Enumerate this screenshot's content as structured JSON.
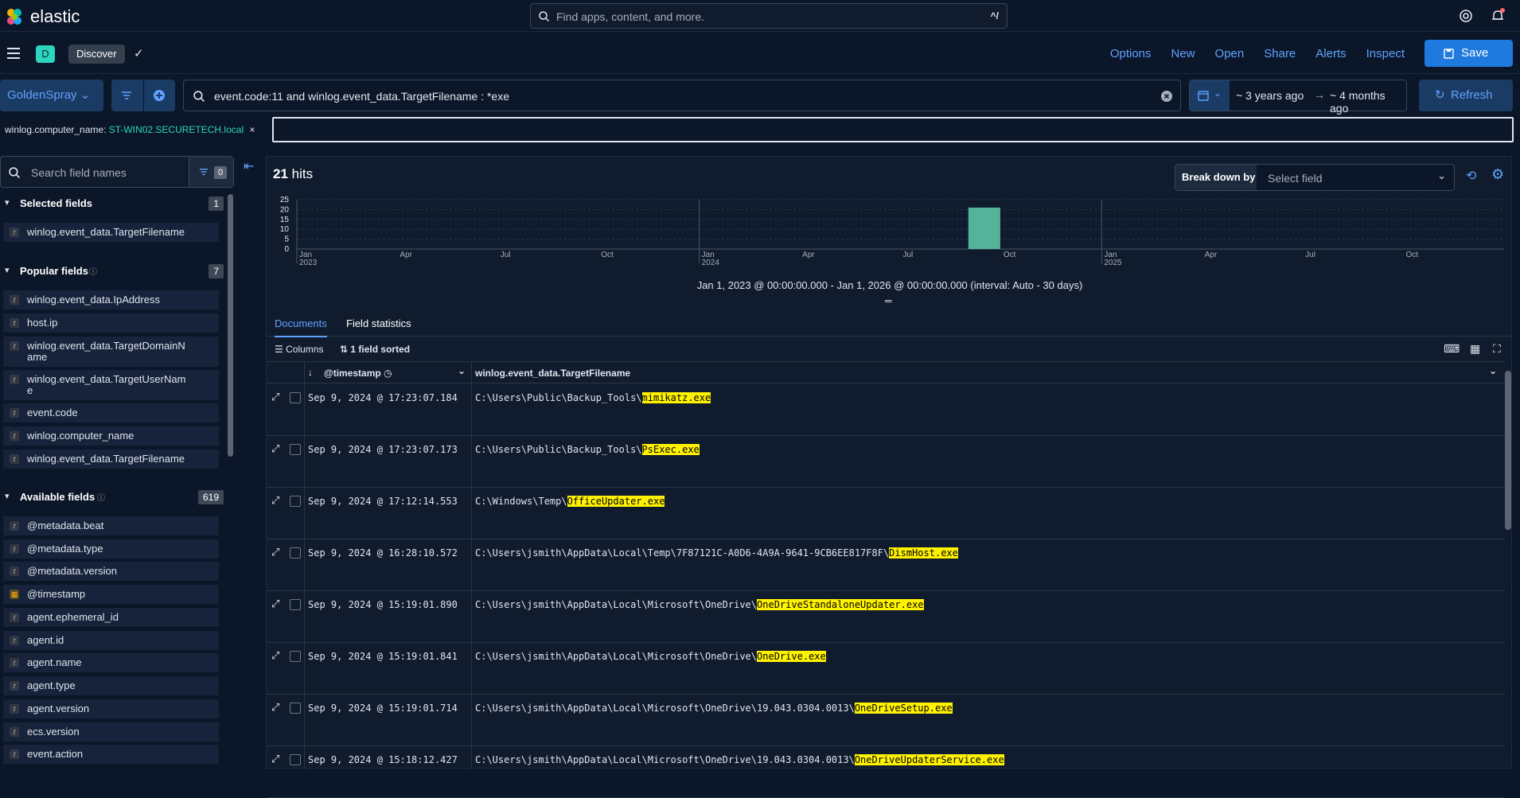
{
  "header": {
    "brand": "elastic",
    "search_placeholder": "Find apps, content, and more.",
    "search_shortcut": "^/"
  },
  "appbar": {
    "space_badge": "D",
    "breadcrumb": "Discover",
    "links": [
      "Options",
      "New",
      "Open",
      "Share",
      "Alerts",
      "Inspect"
    ],
    "save_label": "Save"
  },
  "querybar": {
    "data_view": "GoldenSpray",
    "query": "event.code:11 and winlog.event_data.TargetFilename : *exe",
    "date_start": "~ 3 years ago",
    "date_end": "~ 4 months ago",
    "refresh_label": "Refresh"
  },
  "filters": [
    {
      "key": "winlog.computer_name:",
      "value": "ST-WIN02.SECURETECH.local"
    }
  ],
  "sidebar": {
    "search_placeholder": "Search field names",
    "filter_count": "0",
    "selected": {
      "title": "Selected fields",
      "count": "1",
      "items": [
        "winlog.event_data.TargetFilename"
      ]
    },
    "popular": {
      "title": "Popular fields",
      "count": "7",
      "items": [
        "winlog.event_data.IpAddress",
        "host.ip",
        "winlog.event_data.TargetDomainName",
        "winlog.event_data.TargetUserName",
        "event.code",
        "winlog.computer_name",
        "winlog.event_data.TargetFilename"
      ]
    },
    "available": {
      "title": "Available fields",
      "count": "619",
      "items": [
        "@metadata.beat",
        "@metadata.type",
        "@metadata.version",
        "@timestamp",
        "agent.ephemeral_id",
        "agent.id",
        "agent.name",
        "agent.type",
        "agent.version",
        "ecs.version",
        "event.action"
      ]
    }
  },
  "main": {
    "hits_count": "21",
    "hits_label": "hits",
    "breakdown_label": "Break down by",
    "breakdown_placeholder": "Select field",
    "interval_text": "Jan 1, 2023 @ 00:00:00.000 - Jan 1, 2026 @ 00:00:00.000 (interval: Auto - 30 days)",
    "tabs": [
      "Documents",
      "Field statistics"
    ],
    "columns_label": "Columns",
    "sorted_label": "1 field sorted",
    "col_timestamp": "@timestamp",
    "col_filename": "winlog.event_data.TargetFilename"
  },
  "chart_data": {
    "type": "bar",
    "yticks": [
      "25",
      "20",
      "15",
      "10",
      "5",
      "0"
    ],
    "ylim": [
      0,
      25
    ],
    "xticks": [
      {
        "label": "Jan",
        "sub": "2023"
      },
      {
        "label": "Apr",
        "sub": ""
      },
      {
        "label": "Jul",
        "sub": ""
      },
      {
        "label": "Oct",
        "sub": ""
      },
      {
        "label": "Jan",
        "sub": "2024"
      },
      {
        "label": "Apr",
        "sub": ""
      },
      {
        "label": "Jul",
        "sub": ""
      },
      {
        "label": "Oct",
        "sub": ""
      },
      {
        "label": "Jan",
        "sub": "2025"
      },
      {
        "label": "Apr",
        "sub": ""
      },
      {
        "label": "Jul",
        "sub": ""
      },
      {
        "label": "Oct",
        "sub": ""
      }
    ],
    "bars": [
      {
        "x": "2024-09",
        "value": 21
      }
    ],
    "bar_color": "#54b399"
  },
  "rows": [
    {
      "ts": "Sep 9, 2024 @ 17:23:07.184",
      "path": "C:\\Users\\Public\\Backup_Tools\\",
      "hl": "mimikatz.exe"
    },
    {
      "ts": "Sep 9, 2024 @ 17:23:07.173",
      "path": "C:\\Users\\Public\\Backup_Tools\\",
      "hl": "PsExec.exe"
    },
    {
      "ts": "Sep 9, 2024 @ 17:12:14.553",
      "path": "C:\\Windows\\Temp\\",
      "hl": "OfficeUpdater.exe"
    },
    {
      "ts": "Sep 9, 2024 @ 16:28:10.572",
      "path": "C:\\Users\\jsmith\\AppData\\Local\\Temp\\7F87121C-A0D6-4A9A-9641-9CB6EE817F8F\\",
      "hl": "DismHost.exe"
    },
    {
      "ts": "Sep 9, 2024 @ 15:19:01.890",
      "path": "C:\\Users\\jsmith\\AppData\\Local\\Microsoft\\OneDrive\\",
      "hl": "OneDriveStandaloneUpdater.exe"
    },
    {
      "ts": "Sep 9, 2024 @ 15:19:01.841",
      "path": "C:\\Users\\jsmith\\AppData\\Local\\Microsoft\\OneDrive\\",
      "hl": "OneDrive.exe"
    },
    {
      "ts": "Sep 9, 2024 @ 15:19:01.714",
      "path": "C:\\Users\\jsmith\\AppData\\Local\\Microsoft\\OneDrive\\19.043.0304.0013\\",
      "hl": "OneDriveSetup.exe"
    },
    {
      "ts": "Sep 9, 2024 @ 15:18:12.427",
      "path": "C:\\Users\\jsmith\\AppData\\Local\\Microsoft\\OneDrive\\19.043.0304.0013\\",
      "hl": "OneDriveUpdaterService.exe"
    }
  ]
}
